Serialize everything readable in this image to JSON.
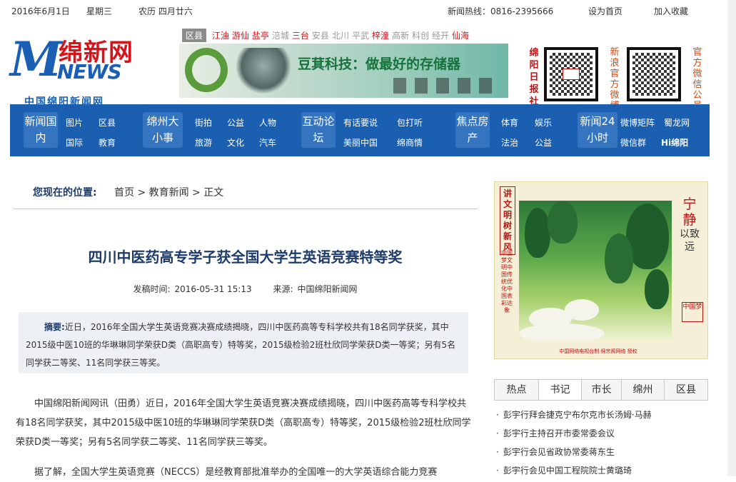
{
  "topbar": {
    "date": "2016年6月1日",
    "weekday": "星期三",
    "lunar": "农历  四月廿六",
    "hotline": "新闻热线：0816-2395666",
    "set_home": "设为首页",
    "favorite": "加入收藏"
  },
  "logo": {
    "m": "M",
    "cn": "绵新网",
    "news": "NEWS",
    "sub": "中国绵阳新闻网"
  },
  "counties": {
    "label": "区县",
    "items": [
      {
        "name": "江油",
        "color": "#d7141a"
      },
      {
        "name": "游仙",
        "color": "#d7141a"
      },
      {
        "name": "盐亭",
        "color": "#d7141a"
      },
      {
        "name": "涪城",
        "color": "#999999"
      },
      {
        "name": "三台",
        "color": "#d7141a"
      },
      {
        "name": "安县",
        "color": "#999999"
      },
      {
        "name": "北川",
        "color": "#999999"
      },
      {
        "name": "平武",
        "color": "#999999"
      },
      {
        "name": "梓潼",
        "color": "#d7141a"
      },
      {
        "name": "高新",
        "color": "#999999"
      },
      {
        "name": "科创",
        "color": "#999999"
      },
      {
        "name": "经开",
        "color": "#999999"
      },
      {
        "name": "仙海",
        "color": "#d7141a"
      }
    ]
  },
  "banner": {
    "text": "豆萁科技：做最好的存储器"
  },
  "weibo": {
    "seal": "绵阳日报社",
    "label": "新浪官方微博"
  },
  "wechat": {
    "label": "官方微信公号"
  },
  "nav": {
    "groups": [
      {
        "label": "新闻国内",
        "links": [
          "图片",
          "区县",
          "国际",
          "教育"
        ]
      },
      {
        "label": "绵州大小事",
        "links": [
          "街拍",
          "公益",
          "人物",
          "旅游",
          "文化",
          "汽车"
        ]
      },
      {
        "label": "互动论坛",
        "links": [
          "有话要说",
          "包打听",
          "美丽中国",
          "绵商情"
        ]
      },
      {
        "label": "焦点房产",
        "links": [
          "体育",
          "娱乐",
          "法治",
          "公益"
        ]
      },
      {
        "label": "新闻24小时",
        "links": [
          "微博矩阵",
          "蜀龙网",
          "微信群",
          "Hi绵阳"
        ]
      }
    ]
  },
  "breadcrumb": {
    "label": "您现在的位置:",
    "path": "首页  >  教育新闻  >  正文"
  },
  "article": {
    "title": "四川中医药高专学子获全国大学生英语竞赛特等奖",
    "date_label": "发稿时间:",
    "date": "2016-05-31 15:13",
    "source_label": "来源:",
    "source": "中国绵阳新闻网",
    "abstract_label": "摘要:",
    "abstract": "近日，2016年全国大学生英语竞赛决赛成绩揭晓，四川中医药高等专科学校共有18名同学获奖，其中2015级中医10班的华琳琳同学荣获D类（高职高专）特等奖，2015级检验2班杜欣同学荣获D类一等奖；另有5名同学获二等奖、11名同学获三等奖。",
    "paragraphs": [
      "中国绵阳新闻网讯（田勇）近日，2016年全国大学生英语竞赛决赛成绩揭晓，四川中医药高等专科学校共有18名同学获奖，其中2015级中医10班的华琳琳同学荣获D类（高职高专）特等奖，2015级检验2班杜欣同学荣获D类一等奖；另有5名同学获二等奖、11名同学获三等奖。",
      "据了解，全国大学生英语竞赛（NECCS）是经教育部批准举办的全国唯一的大学英语综合能力竞赛"
    ]
  },
  "ad": {
    "vertical": "讲文明树新风",
    "small": "中国梦文明中国传统优化中国表彩达象",
    "quote_big": "宁静",
    "quote_small": "以致远",
    "stamp": "中国梦",
    "foot": "中国网络电视台制  绵宗阁网络  授权"
  },
  "tabs": [
    "热点",
    "书记",
    "市长",
    "绵州",
    "区县"
  ],
  "news": [
    "彭宇行拜会捷克宁布尔克市长汤姆·马赫",
    "彭宇行主持召开市委常委会议",
    "彭宇行会见省政协常委蒋东生",
    "彭宇行会见中国工程院院士黄璐琦"
  ]
}
